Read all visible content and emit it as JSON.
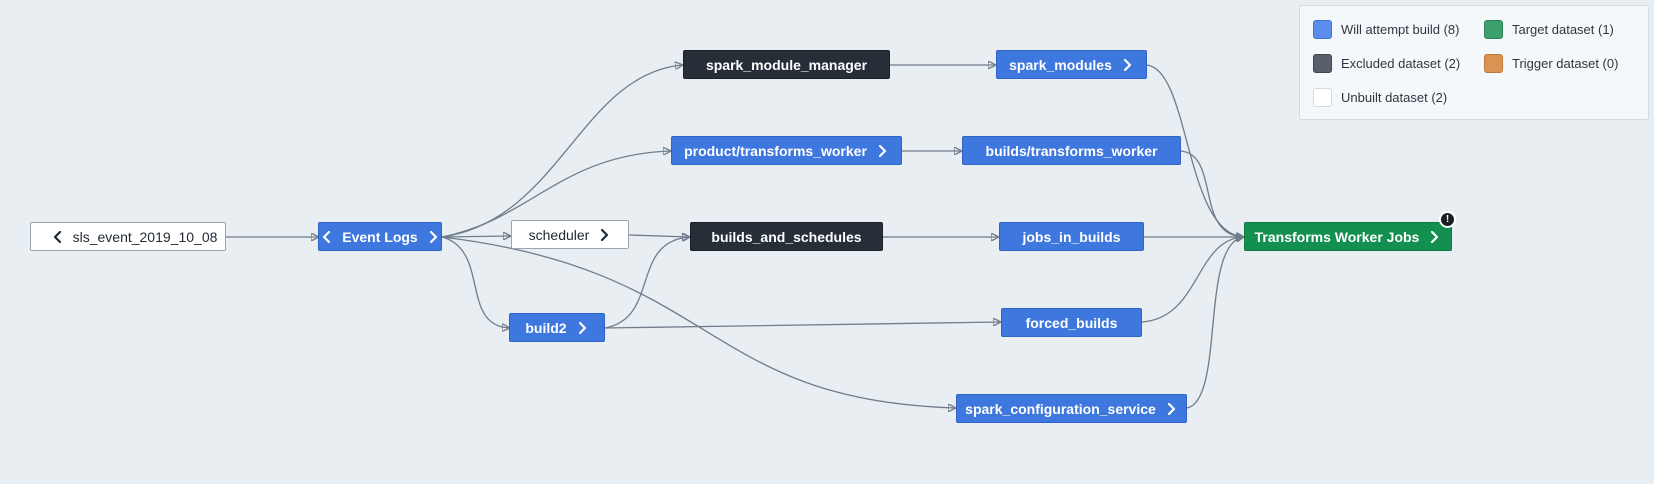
{
  "nodes": {
    "sls_event": {
      "label": "sls_event_2019_10_08"
    },
    "event_logs": {
      "label": "Event Logs"
    },
    "scheduler": {
      "label": "scheduler"
    },
    "build2": {
      "label": "build2"
    },
    "spark_module_manager": {
      "label": "spark_module_manager"
    },
    "product_transforms_worker": {
      "label": "product/transforms_worker"
    },
    "builds_and_schedules": {
      "label": "builds_and_schedules"
    },
    "spark_modules": {
      "label": "spark_modules"
    },
    "builds_transforms_worker": {
      "label": "builds/transforms_worker"
    },
    "jobs_in_builds": {
      "label": "jobs_in_builds"
    },
    "forced_builds": {
      "label": "forced_builds"
    },
    "spark_configuration_service": {
      "label": "spark_configuration_service"
    },
    "transforms_worker_jobs": {
      "label": "Transforms Worker Jobs",
      "warning": "!"
    }
  },
  "legend": {
    "will_attempt": {
      "label": "Will attempt build (8)",
      "color": "#5b8def"
    },
    "target": {
      "label": "Target dataset (1)",
      "color": "#3d9e6e"
    },
    "excluded": {
      "label": "Excluded dataset (2)",
      "color": "#58616b"
    },
    "trigger": {
      "label": "Trigger dataset (0)",
      "color": "#d99453"
    },
    "unbuilt": {
      "label": "Unbuilt dataset (2)",
      "color": "#ffffff"
    }
  }
}
